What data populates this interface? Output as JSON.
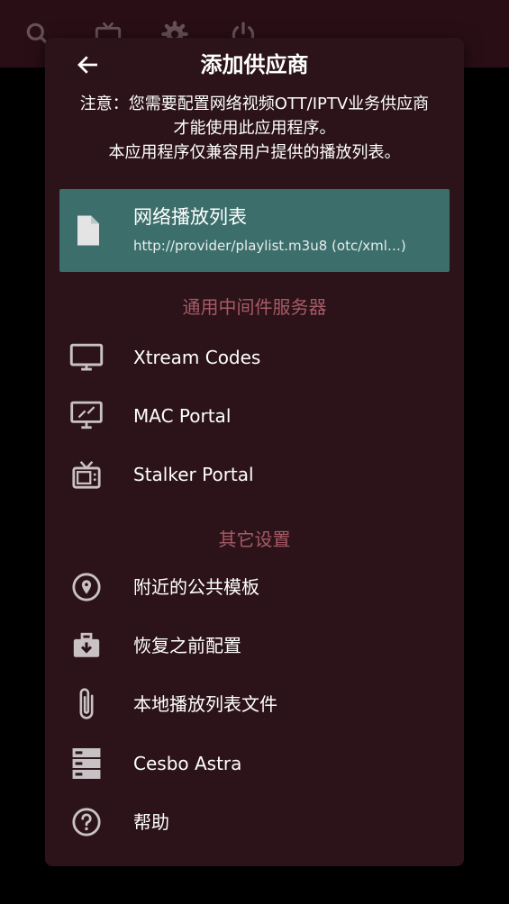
{
  "dialog": {
    "title": "添加供应商",
    "notice_line1": "注意：您需要配置网络视频OTT/IPTV业务供应商",
    "notice_line2": "才能使用此应用程序。",
    "notice_line3": "本应用程序仅兼容用户提供的播放列表。"
  },
  "selected_item": {
    "title": "网络播放列表",
    "subtitle": "http://provider/playlist.m3u8 (otc/xml…)"
  },
  "sections": {
    "middleware": "通用中间件服务器",
    "other": "其它设置"
  },
  "middleware_items": [
    {
      "label": "Xtream Codes",
      "icon": "monitor-icon"
    },
    {
      "label": "MAC Portal",
      "icon": "portal-monitor-icon"
    },
    {
      "label": "Stalker Portal",
      "icon": "tv-icon"
    }
  ],
  "other_items": [
    {
      "label": "附近的公共模板",
      "icon": "location-pin-icon"
    },
    {
      "label": "恢复之前配置",
      "icon": "briefcase-download-icon"
    },
    {
      "label": "本地播放列表文件",
      "icon": "paperclip-icon"
    },
    {
      "label": "Cesbo Astra",
      "icon": "server-icon"
    },
    {
      "label": "帮助",
      "icon": "help-circle-icon"
    }
  ],
  "colors": {
    "dialog_bg": "#2b1319",
    "selected_bg": "#3c6f6b",
    "section_header": "#a65a66",
    "icon": "#c9c2c4"
  }
}
